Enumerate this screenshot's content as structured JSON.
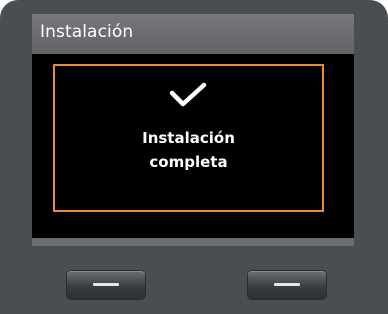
{
  "screen": {
    "title": "Instalación",
    "dialog": {
      "icon": "checkmark-icon",
      "message_line1": "Instalación",
      "message_line2": "completa"
    }
  },
  "colors": {
    "dialog_border": "#e98a3c",
    "title_bar": "#6b6d70",
    "device_body": "#4a4d52",
    "content_background": "#000000"
  },
  "softkeys": [
    {
      "icon": "dash-icon"
    },
    {
      "icon": "dash-icon"
    }
  ]
}
